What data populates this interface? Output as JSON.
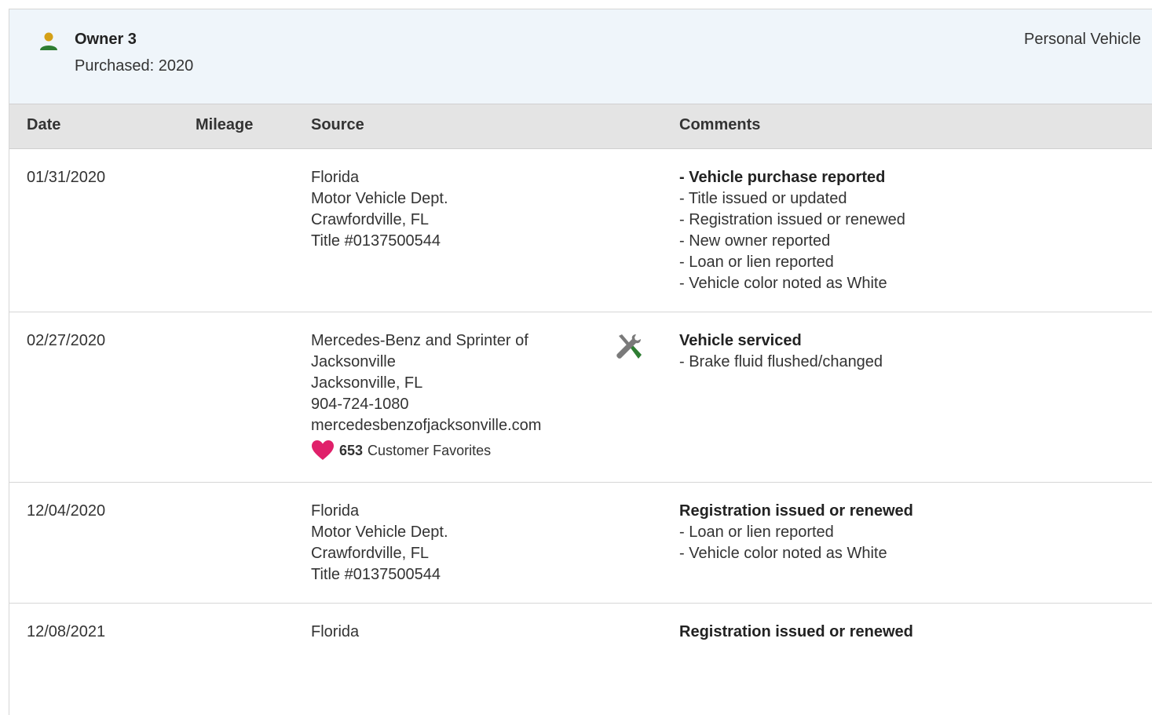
{
  "owner": {
    "title": "Owner 3",
    "purchased": "Purchased: 2020",
    "type": "Personal Vehicle",
    "icon": "person-icon",
    "icon_color": "#2e7d32",
    "head_color": "#d4a017"
  },
  "columns": {
    "date": "Date",
    "mileage": "Mileage",
    "source": "Source",
    "comments": "Comments"
  },
  "records": [
    {
      "date": "01/31/2020",
      "mileage": "",
      "source": [
        "Florida",
        "Motor Vehicle Dept.",
        "Crawfordville, FL",
        "Title #0137500544"
      ],
      "comment_title": "Vehicle purchase reported",
      "comment_items": [
        "Title issued or updated",
        "Registration issued or renewed",
        "New owner reported",
        "Loan or lien reported",
        "Vehicle color noted as White"
      ]
    },
    {
      "date": "02/27/2020",
      "mileage": "",
      "source": [
        "Mercedes-Benz and Sprinter of",
        "Jacksonville",
        "Jacksonville, FL",
        "904-724-1080",
        "mercedesbenzofjacksonville.com"
      ],
      "favorites_count": "653",
      "favorites_label": "Customer Favorites",
      "icon": "service-tools-icon",
      "comment_title": "Vehicle serviced",
      "comment_items": [
        "Brake fluid flushed/changed"
      ]
    },
    {
      "date": "12/04/2020",
      "mileage": "",
      "source": [
        "Florida",
        "Motor Vehicle Dept.",
        "Crawfordville, FL",
        "Title #0137500544"
      ],
      "comment_title": "Registration issued or renewed",
      "comment_items": [
        "Loan or lien reported",
        "Vehicle color noted as White"
      ]
    },
    {
      "date": "12/08/2021",
      "mileage": "",
      "source": [
        "Florida"
      ],
      "comment_title": "Registration issued or renewed",
      "comment_items": []
    }
  ],
  "colors": {
    "header_bg": "#eff5fa",
    "table_head_bg": "#e4e4e4",
    "heart": "#e0206a",
    "tool_gray": "#7a7a7a",
    "tool_green": "#2e7d32"
  }
}
